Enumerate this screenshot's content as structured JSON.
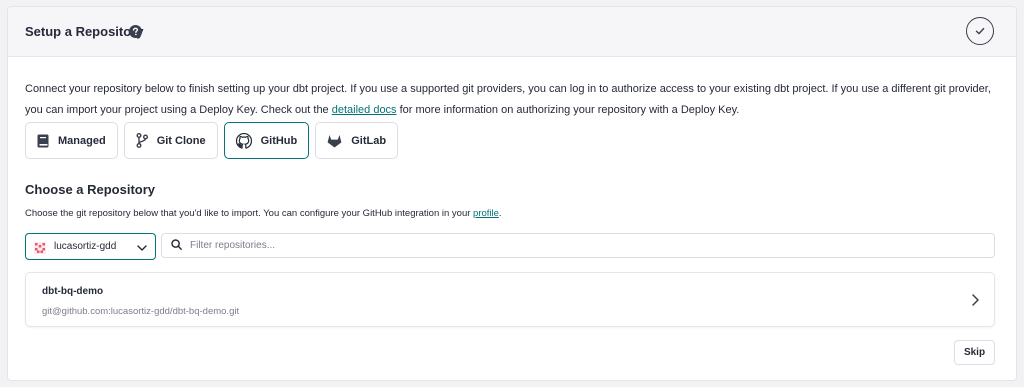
{
  "header": {
    "title": "Setup a Repository",
    "help_icon": "question-circle-icon",
    "status_icon": "check-circle-icon"
  },
  "intro": {
    "text_before_link": "Connect your repository below to finish setting up your dbt project. If you use a supported git providers, you can log in to authorize access to your existing dbt project. If you use a different git provider, you can import your project using a Deploy Key. Check out the ",
    "link_text": "detailed docs",
    "text_after_link": " for more information on authorizing your repository with a Deploy Key."
  },
  "providers": [
    {
      "label": "Managed",
      "icon": "book-icon",
      "active": false
    },
    {
      "label": "Git Clone",
      "icon": "git-branch-icon",
      "active": false
    },
    {
      "label": "GitHub",
      "icon": "github-icon",
      "active": true
    },
    {
      "label": "GitLab",
      "icon": "gitlab-icon",
      "active": false
    }
  ],
  "choose": {
    "title": "Choose a Repository",
    "desc_before_link": "Choose the git repository below that you'd like to import. You can configure your GitHub integration in your ",
    "link_text": "profile",
    "desc_after_link": "."
  },
  "account_select": {
    "value": "lucasortiz-gdd",
    "icon": "account-avatar-icon"
  },
  "filter": {
    "placeholder": "Filter repositories...",
    "value": ""
  },
  "repositories": [
    {
      "name": "dbt-bq-demo",
      "url": "git@github.com:lucasortiz-gdd/dbt-bq-demo.git"
    }
  ],
  "footer": {
    "skip_label": "Skip"
  },
  "colors": {
    "accent": "#047377",
    "text": "#262a38",
    "muted": "#7b7f8a",
    "gitlab": "#3a3f4d"
  }
}
